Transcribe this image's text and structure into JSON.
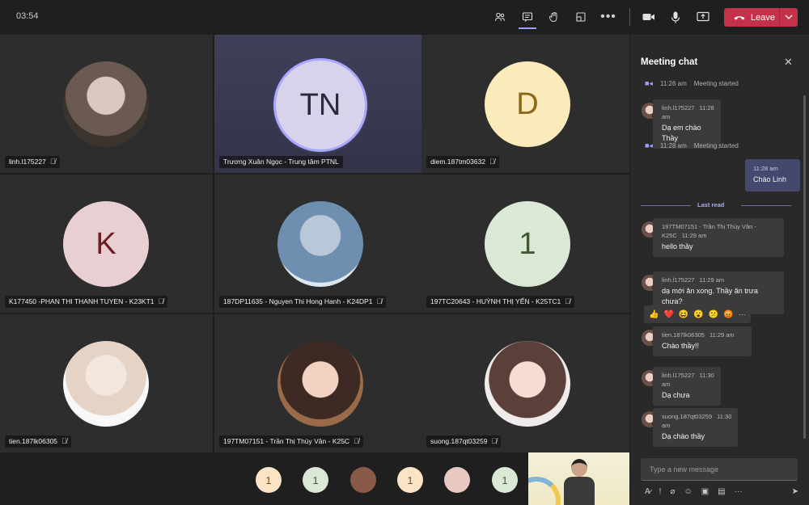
{
  "toolbar": {
    "timer": "03:54",
    "leave_label": "Leave",
    "icons": [
      "people-icon",
      "chat-icon",
      "raise-hand-icon",
      "share-tray-icon",
      "more-icon",
      "camera-icon",
      "microphone-icon",
      "share-screen-icon",
      "phone-icon",
      "chevron-down-icon"
    ]
  },
  "tiles": [
    {
      "name": "linh.l175227",
      "type": "photo"
    },
    {
      "name": "Trương Xuân Ngọc - Trung tâm PTNL",
      "initials": "TN",
      "bg": "#d8d2ea",
      "fg": "#2a2a3a"
    },
    {
      "name": "diem.187tm03632",
      "initials": "D",
      "bg": "#fbeaba",
      "fg": "#8a6a1a"
    },
    {
      "name": "K177450 -PHAN THI THANH TUYEN - K23KT1",
      "initials": "K",
      "bg": "#e8d0d2",
      "fg": "#6b1f24"
    },
    {
      "name": "187DP11635 - Nguyen Thi Hong Hanh - K24DP1",
      "type": "photo"
    },
    {
      "name": "197TC20643 - HUỲNH THỊ YẾN - K25TC1",
      "initials": "1",
      "bg": "#dce8d6",
      "fg": "#3f5a32"
    },
    {
      "name": "tien.187lk06305",
      "type": "photo"
    },
    {
      "name": "197TM07151 - Trần Thị Thùy Vân - K25C",
      "type": "photo"
    },
    {
      "name": "suong.187qt03259",
      "type": "photo"
    }
  ],
  "bottom_avatars": [
    {
      "label": "1",
      "bg": "#fbe3c6",
      "fg": "#7a4a1a"
    },
    {
      "label": "1",
      "bg": "#dce8d6",
      "fg": "#3f5a32"
    },
    {
      "label": "",
      "bg": "#8a5a48",
      "fg": "#fff"
    },
    {
      "label": "1",
      "bg": "#fbe3c6",
      "fg": "#7a4a1a"
    },
    {
      "label": "",
      "bg": "#e8c8c0",
      "fg": "#fff"
    },
    {
      "label": "1",
      "bg": "#dce8d6",
      "fg": "#3f5a32"
    }
  ],
  "chat": {
    "title": "Meeting chat",
    "system": [
      {
        "time": "11:26 am",
        "text": "Meeting started"
      },
      {
        "time": "11:28 am",
        "text": "Meeting started"
      }
    ],
    "messages": [
      {
        "author": "linh.l175227",
        "time": "11:28 am",
        "text": "Dạ em chào Thầy"
      },
      {
        "author": "197TM07151 - Trần Thị Thùy Vân -",
        "author2": "K25C",
        "time": "11:29 am",
        "text": "hello thầy"
      },
      {
        "author": "linh.l175227",
        "time": "11:29 am",
        "text": "dạ mới ăn xong. Thầy ăn trưa",
        "text2": "chưa?"
      },
      {
        "author": "tien.187lk06305",
        "time": "11:29 am",
        "text": "Chào thầy!!"
      },
      {
        "author": "linh.l175227",
        "time": "11:30 am",
        "text": "Dạ chưa"
      },
      {
        "author": "suong.187qt03259",
        "time": "11:30 am",
        "text": "Dạ chào thầy"
      }
    ],
    "mine": {
      "time": "11:28 am",
      "text": "Chào Linh"
    },
    "last_read": "Last read",
    "reactions": [
      "👍",
      "❤️",
      "😆",
      "😮",
      "😕",
      "😡",
      "···"
    ],
    "compose_placeholder": "Type a new message"
  }
}
